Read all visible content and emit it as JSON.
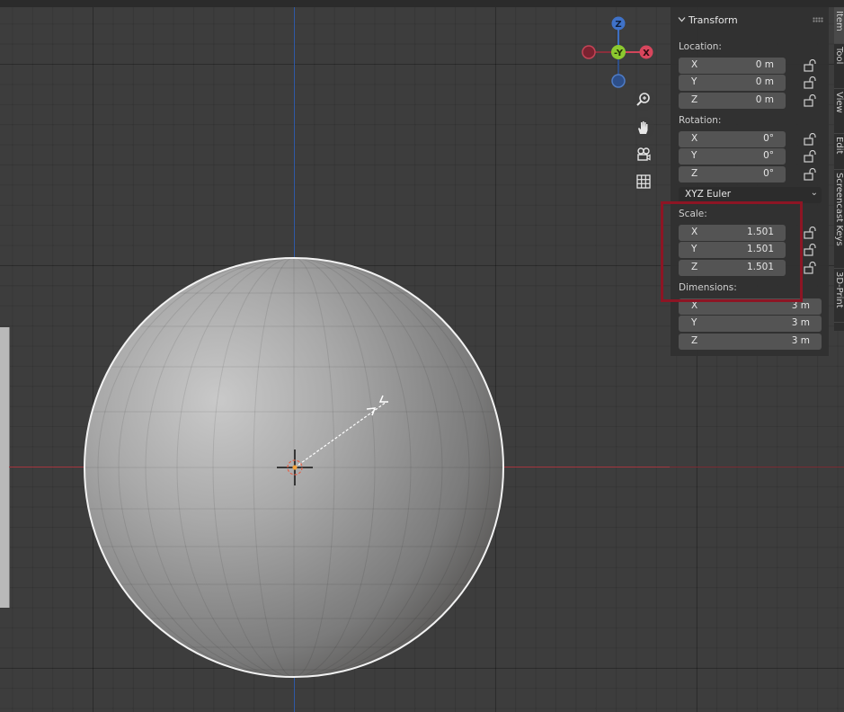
{
  "gizmo": {
    "z": "Z",
    "y": "-Y",
    "x": "X"
  },
  "panel": {
    "title": "Transform",
    "location": {
      "label": "Location:",
      "rows": [
        {
          "axis": "X",
          "value": "0 m"
        },
        {
          "axis": "Y",
          "value": "0 m"
        },
        {
          "axis": "Z",
          "value": "0 m"
        }
      ]
    },
    "rotation": {
      "label": "Rotation:",
      "rows": [
        {
          "axis": "X",
          "value": "0°"
        },
        {
          "axis": "Y",
          "value": "0°"
        },
        {
          "axis": "Z",
          "value": "0°"
        }
      ],
      "mode": "XYZ Euler"
    },
    "scale": {
      "label": "Scale:",
      "rows": [
        {
          "axis": "X",
          "value": "1.501"
        },
        {
          "axis": "Y",
          "value": "1.501"
        },
        {
          "axis": "Z",
          "value": "1.501"
        }
      ]
    },
    "dimensions": {
      "label": "Dimensions:",
      "rows": [
        {
          "axis": "X",
          "value": "3 m"
        },
        {
          "axis": "Y",
          "value": "3 m"
        },
        {
          "axis": "Z",
          "value": "3 m"
        }
      ]
    }
  },
  "tabs": [
    "Item",
    "Tool",
    "View",
    "Edit",
    "Screencast Keys",
    "3D-Print"
  ],
  "nav_tools": [
    "zoom-icon",
    "hand-icon",
    "camera-icon",
    "grid-icon"
  ],
  "colors": {
    "x_axis": "#a5353f",
    "y_axis": "#2f59a6",
    "highlight": "#8d1524"
  }
}
